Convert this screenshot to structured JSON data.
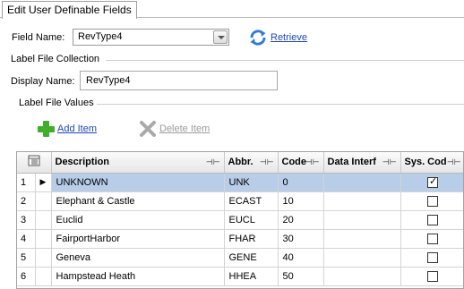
{
  "tab": {
    "label": "Edit User Definable Fields"
  },
  "field": {
    "label": "Field Name:",
    "value": "RevType4"
  },
  "retrieve": {
    "label": "Retrieve",
    "icon": "refresh-icon"
  },
  "label_file_collection": {
    "title": "Label File Collection",
    "display_label": "Display Name:",
    "display_value": "RevType4"
  },
  "label_file_values": {
    "title": "Label File Values",
    "add_label": "Add Item",
    "delete_label": "Delete Item"
  },
  "grid": {
    "columns": [
      "Description",
      "Abbr.",
      "Code",
      "Data Interf",
      "Sys. Cod"
    ],
    "rows": [
      {
        "num": "1",
        "description": "UNKNOWN",
        "abbr": "UNK",
        "code": "0",
        "data_interface": "",
        "sys_code": true
      },
      {
        "num": "2",
        "description": "Elephant & Castle",
        "abbr": "ECAST",
        "code": "10",
        "data_interface": "",
        "sys_code": false
      },
      {
        "num": "3",
        "description": "Euclid",
        "abbr": "EUCL",
        "code": "20",
        "data_interface": "",
        "sys_code": false
      },
      {
        "num": "4",
        "description": "FairportHarbor",
        "abbr": "FHAR",
        "code": "30",
        "data_interface": "",
        "sys_code": false
      },
      {
        "num": "5",
        "description": "Geneva",
        "abbr": "GENE",
        "code": "40",
        "data_interface": "",
        "sys_code": false
      },
      {
        "num": "6",
        "description": "Hampstead Heath",
        "abbr": "HHEA",
        "code": "50",
        "data_interface": "",
        "sys_code": false
      }
    ]
  },
  "colors": {
    "link": "#1d46b8",
    "selected_row": "#b7cde8",
    "add_icon": "#3fae2a"
  }
}
